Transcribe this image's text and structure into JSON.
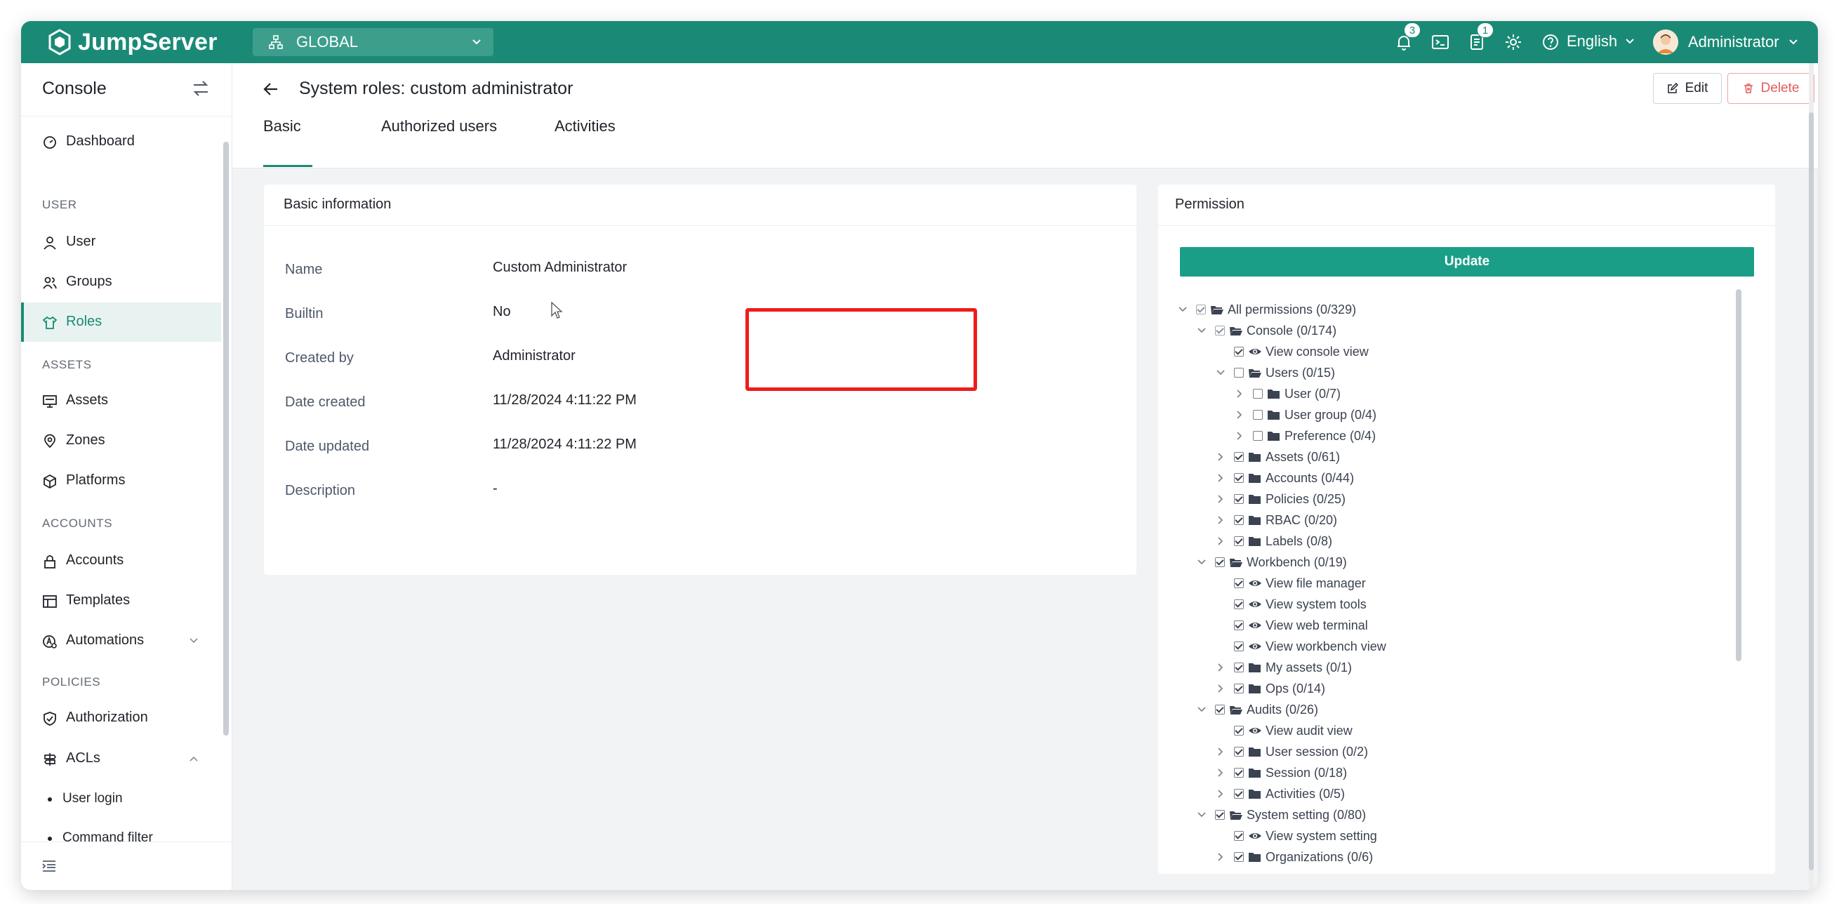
{
  "app": {
    "brand": "JumpServer",
    "org": "GLOBAL",
    "notifications_count": "3",
    "tickets_count": "1",
    "language": "English",
    "user_name": "Administrator",
    "accent_color": "#1a8a76"
  },
  "sidebar": {
    "title": "Console",
    "sections": {
      "user": "USER",
      "assets": "ASSETS",
      "accounts": "ACCOUNTS",
      "policies": "POLICIES"
    },
    "items": {
      "dashboard": "Dashboard",
      "user": "User",
      "groups": "Groups",
      "roles": "Roles",
      "assets": "Assets",
      "zones": "Zones",
      "platforms": "Platforms",
      "accounts": "Accounts",
      "templates": "Templates",
      "automations": "Automations",
      "authorization": "Authorization",
      "acls": "ACLs",
      "user_login": "User login",
      "command_filter": "Command filter"
    },
    "active": "Roles"
  },
  "page": {
    "title": "System roles: custom administrator",
    "edit_label": "Edit",
    "delete_label": "Delete",
    "tabs": [
      "Basic",
      "Authorized users",
      "Activities"
    ],
    "active_tab": "Basic"
  },
  "basic_info": {
    "title": "Basic information",
    "rows": [
      {
        "label": "Name",
        "value": "Custom Administrator"
      },
      {
        "label": "Builtin",
        "value": "No"
      },
      {
        "label": "Created by",
        "value": "Administrator"
      },
      {
        "label": "Date created",
        "value": "11/28/2024 4:11:22 PM"
      },
      {
        "label": "Date updated",
        "value": "11/28/2024 4:11:22 PM"
      },
      {
        "label": "Description",
        "value": "-"
      }
    ]
  },
  "permission": {
    "title": "Permission",
    "update_label": "Update",
    "tree": [
      {
        "label": "All permissions (0/329)"
      },
      {
        "label": "Console (0/174)"
      },
      {
        "label": "View console view"
      },
      {
        "label": "Users (0/15)"
      },
      {
        "label": "User (0/7)"
      },
      {
        "label": "User group (0/4)"
      },
      {
        "label": "Preference (0/4)"
      },
      {
        "label": "Assets (0/61)"
      },
      {
        "label": "Accounts (0/44)"
      },
      {
        "label": "Policies (0/25)"
      },
      {
        "label": "RBAC (0/20)"
      },
      {
        "label": "Labels (0/8)"
      },
      {
        "label": "Workbench (0/19)"
      },
      {
        "label": "View file manager"
      },
      {
        "label": "View system tools"
      },
      {
        "label": "View web terminal"
      },
      {
        "label": "View workbench view"
      },
      {
        "label": "My assets (0/1)"
      },
      {
        "label": "Ops (0/14)"
      },
      {
        "label": "Audits (0/26)"
      },
      {
        "label": "View audit view"
      },
      {
        "label": "User session (0/2)"
      },
      {
        "label": "Session (0/18)"
      },
      {
        "label": "Activities (0/5)"
      },
      {
        "label": "System setting (0/80)"
      },
      {
        "label": "View system setting"
      },
      {
        "label": "Organizations (0/6)"
      }
    ]
  }
}
